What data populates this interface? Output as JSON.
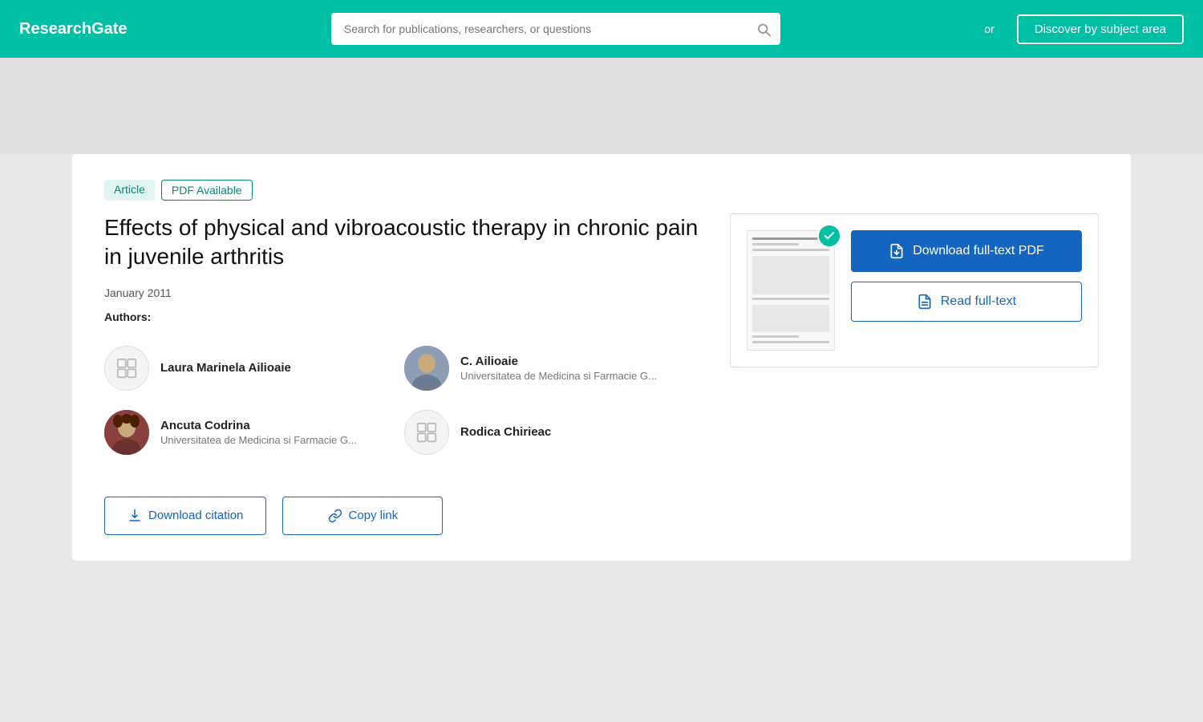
{
  "header": {
    "logo": "ResearchGate",
    "search_placeholder": "Search for publications, researchers, or questions",
    "or_text": "or",
    "discover_btn": "Discover by subject area"
  },
  "article": {
    "badge_article": "Article",
    "badge_pdf": "PDF Available",
    "title": "Effects of physical and vibroacoustic therapy in chronic pain in juvenile arthritis",
    "date": "January 2011",
    "authors_label": "Authors:",
    "authors": [
      {
        "name": "Laura Marinela Ailioaie",
        "affil": "",
        "has_photo": false
      },
      {
        "name": "C. Ailioaie",
        "affil": "Universitatea de Medicina si Farmacie G...",
        "has_photo": true,
        "photo_type": "c2"
      },
      {
        "name": "Ancuta Codrina",
        "affil": "Universitatea de Medicina si Farmacie G...",
        "has_photo": true,
        "photo_type": "c"
      },
      {
        "name": "Rodica Chirieac",
        "affil": "",
        "has_photo": false
      }
    ],
    "pdf_actions": {
      "download_label": "Download full-text PDF",
      "read_label": "Read full-text"
    },
    "bottom_actions": {
      "download_citation": "Download citation",
      "copy_link": "Copy link"
    }
  }
}
